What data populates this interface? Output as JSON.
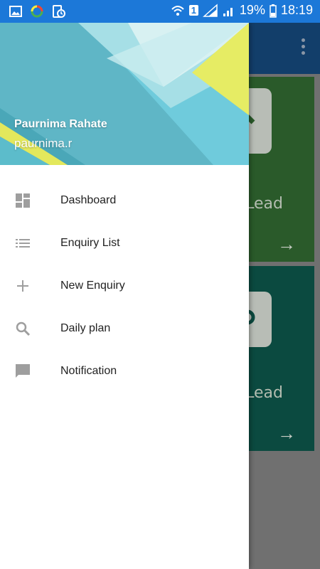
{
  "status_bar": {
    "battery": "19%",
    "time": "18:19",
    "sim": "1"
  },
  "drawer": {
    "user_name": "Paurnima Rahate",
    "user_email": "paurnima.r",
    "items": [
      {
        "label": "Dashboard",
        "icon": "dashboard-icon"
      },
      {
        "label": "Enquiry List",
        "icon": "list-icon"
      },
      {
        "label": "New Enquiry",
        "icon": "plus-icon"
      },
      {
        "label": "Daily plan",
        "icon": "search-icon"
      },
      {
        "label": "Notification",
        "icon": "chat-bubble-icon"
      }
    ]
  },
  "background": {
    "card1_label": "Lead",
    "card2_label": "Lead"
  },
  "colors": {
    "status_bar": "#1c78d8",
    "toolbar": "#123e6a",
    "icon_grey": "#9e9e9e"
  }
}
